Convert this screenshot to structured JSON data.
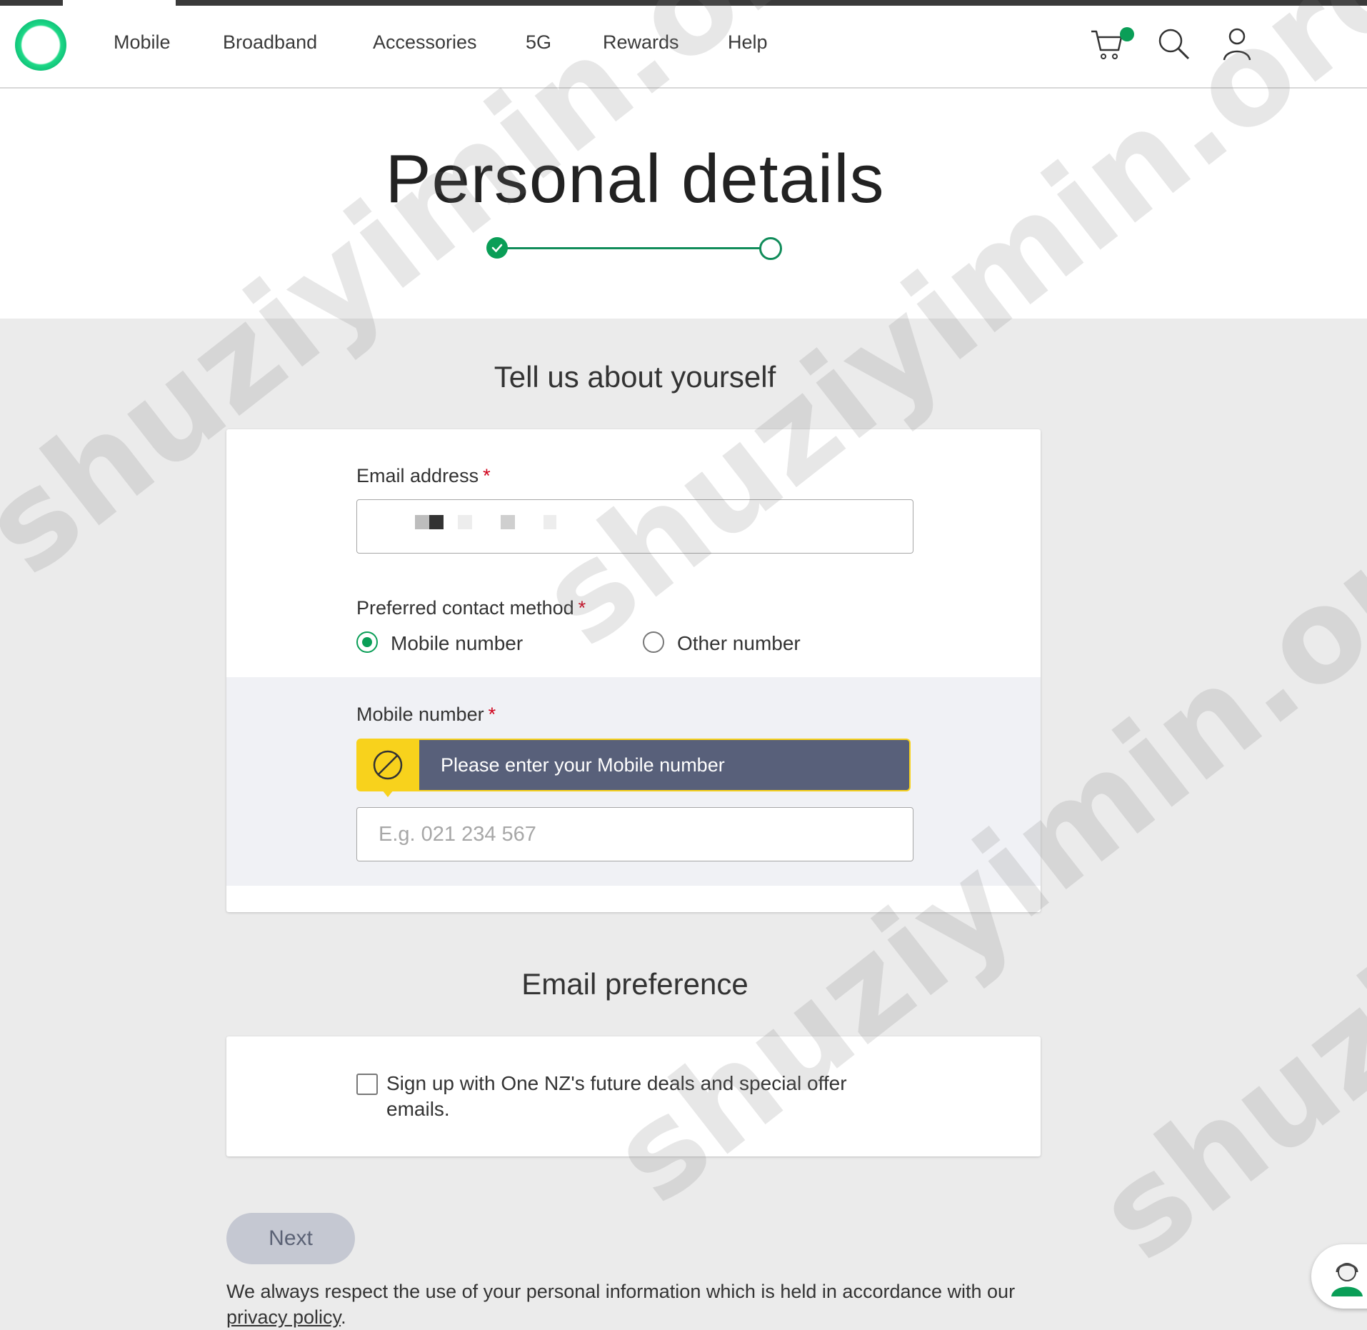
{
  "header": {
    "nav": [
      "Mobile",
      "Broadband",
      "Accessories",
      "5G",
      "Rewards",
      "Help"
    ],
    "icons": [
      "cart-icon",
      "search-icon",
      "user-icon"
    ]
  },
  "hero": {
    "title": "Personal details",
    "steps_completed": 1,
    "steps_total": 2
  },
  "about": {
    "title": "Tell us about yourself",
    "email_label": "Email address",
    "email_value": "",
    "required_mark": "*",
    "contact_label": "Preferred contact method",
    "options": [
      {
        "label": "Mobile number",
        "selected": true
      },
      {
        "label": "Other number",
        "selected": false
      }
    ],
    "mobile_label": "Mobile number",
    "mobile_error": "Please enter your Mobile number",
    "mobile_placeholder": "E.g. 021 234 567"
  },
  "email_pref": {
    "title": "Email preference",
    "checkbox_label": "Sign up with One NZ's future deals and special offer emails.",
    "checked": false
  },
  "actions": {
    "next_label": "Next"
  },
  "privacy": {
    "text": "We always respect the use of your personal information which is held in accordance with our ",
    "link": "privacy policy",
    "end": "."
  },
  "watermark": "shuziyimin.org",
  "colors": {
    "accent": "#0a9e57",
    "error_bg": "#58607a",
    "error_icon": "#f8d21c",
    "required": "#d0021b"
  }
}
